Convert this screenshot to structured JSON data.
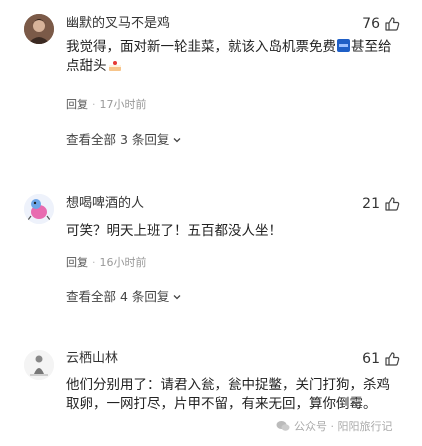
{
  "comments": [
    {
      "username": "幽默的叉马不是鸡",
      "likes": "76",
      "text_part1": "我觉得，面对新一轮韭菜，就该入岛机票免费",
      "text_part2": "甚至给点甜头",
      "reply_label": "回复",
      "time": "17小时前",
      "view_all": "查看全部 3 条回复"
    },
    {
      "username": "想喝啤酒的人",
      "likes": "21",
      "text": "可笑？明天上班了！五百都没人坐！",
      "reply_label": "回复",
      "time": "16小时前",
      "view_all": "查看全部 4 条回复"
    },
    {
      "username": "云栖山林",
      "likes": "61",
      "text": "他们分别用了：请君入瓮，瓮中捉鳖，关门打狗，杀鸡取卵，一网打尽，片甲不留，有来无回，算你倒霉。"
    }
  ],
  "watermark": {
    "text": "公众号 · 阳阳旅行记"
  },
  "colors": {
    "background": "#ffffff",
    "text": "#222222",
    "muted": "#999999",
    "emoji_blue": "#1f5fc6"
  }
}
